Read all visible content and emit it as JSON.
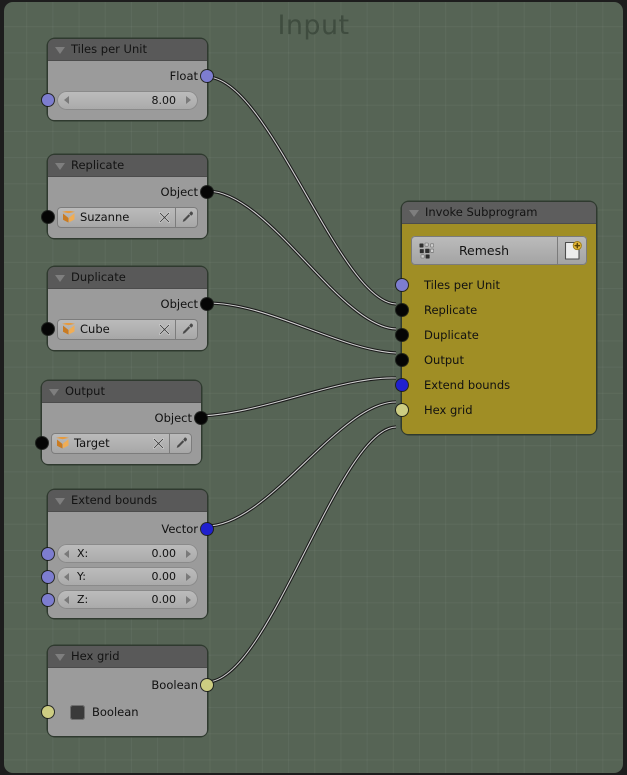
{
  "editor": {
    "watermark": "Input",
    "background_color": "#566455",
    "grid_color": "#5d6b5c"
  },
  "socket_colors": {
    "float": "#7d7dd0",
    "object": "#050505",
    "vector": "#2020cf",
    "boolean": "#cdcd82"
  },
  "nodes": [
    {
      "id": "tiles_per_unit",
      "title": "Tiles per Unit",
      "output_label": "Float",
      "value_label": "",
      "value": "8.00"
    },
    {
      "id": "replicate",
      "title": "Replicate",
      "output_label": "Object",
      "object_name": "Suzanne",
      "clear_icon": "x-icon",
      "pick_icon": "eyedropper-icon"
    },
    {
      "id": "duplicate",
      "title": "Duplicate",
      "output_label": "Object",
      "object_name": "Cube",
      "clear_icon": "x-icon",
      "pick_icon": "eyedropper-icon"
    },
    {
      "id": "output",
      "title": "Output",
      "output_label": "Object",
      "object_name": "Target",
      "clear_icon": "x-icon",
      "pick_icon": "eyedropper-icon"
    },
    {
      "id": "extend_bounds",
      "title": "Extend bounds",
      "output_label": "Vector",
      "fields": [
        {
          "name": "X:",
          "value": "0.00"
        },
        {
          "name": "Y:",
          "value": "0.00"
        },
        {
          "name": "Z:",
          "value": "0.00"
        }
      ]
    },
    {
      "id": "hex_grid",
      "title": "Hex grid",
      "output_label": "Boolean",
      "input_label": "Boolean",
      "checked": false
    }
  ],
  "invoke_node": {
    "title": "Invoke Subprogram",
    "subprogram_name": "Remesh",
    "tree_icon": "node-tree-icon",
    "new_icon": "new-subprogram-icon",
    "inputs": [
      {
        "label": "Tiles per Unit",
        "type": "float"
      },
      {
        "label": "Replicate",
        "type": "object"
      },
      {
        "label": "Duplicate",
        "type": "object"
      },
      {
        "label": "Output",
        "type": "object"
      },
      {
        "label": "Extend bounds",
        "type": "vector"
      },
      {
        "label": "Hex grid",
        "type": "boolean"
      }
    ]
  }
}
